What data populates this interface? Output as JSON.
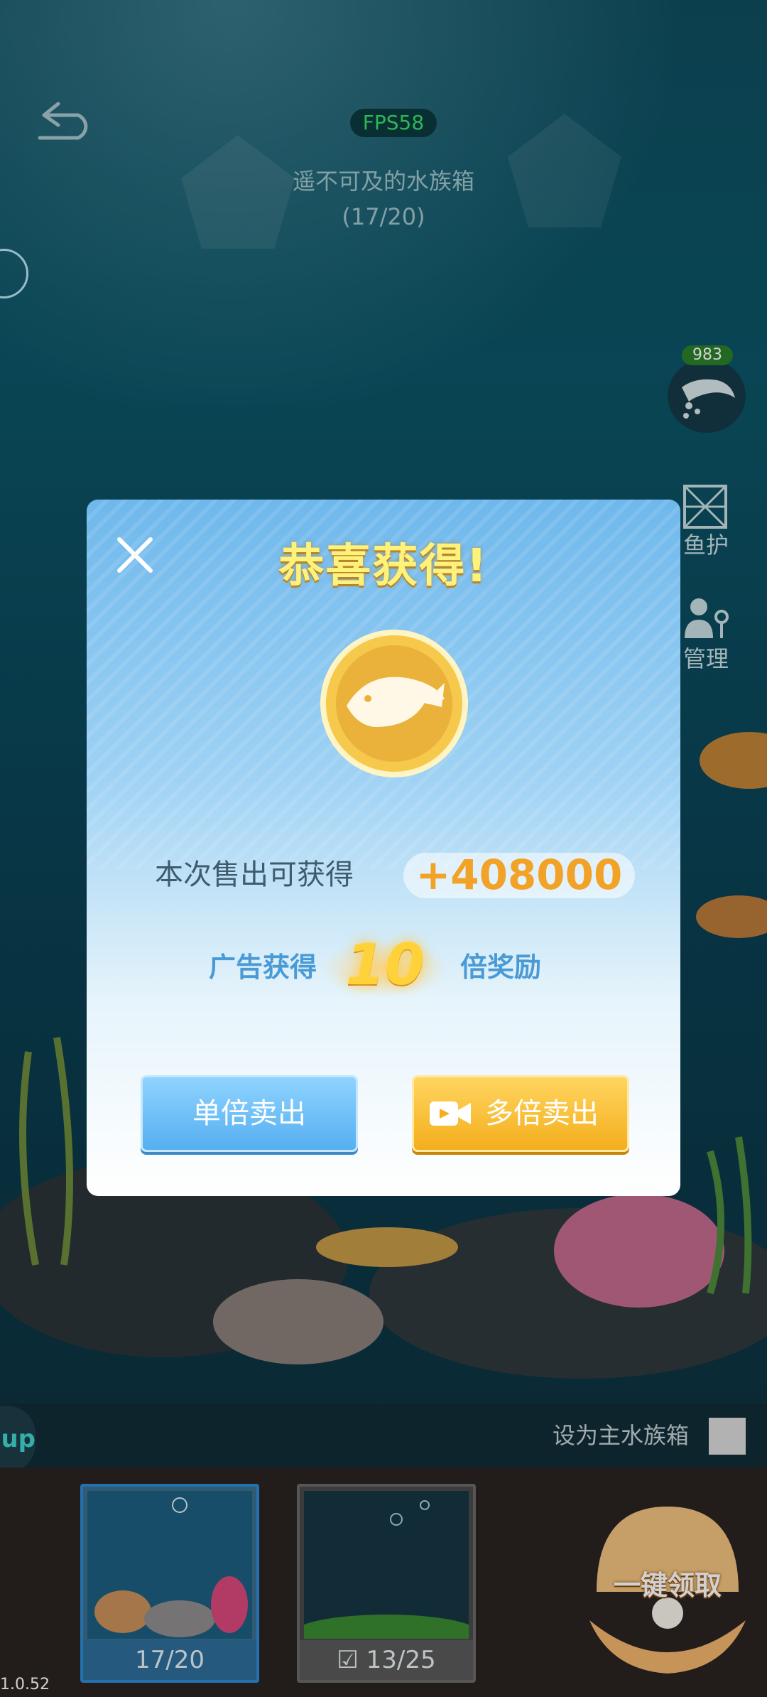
{
  "hud": {
    "fps": "FPS58",
    "tank_name": "遥不可及的水族箱",
    "tank_capacity": "(17/20)",
    "feed_count": "983",
    "side_buttons": [
      "鱼护",
      "管理"
    ]
  },
  "bottom_bar": {
    "set_main_label": "设为主水族箱",
    "up_label": "up",
    "tanks": [
      {
        "caption": "17/20",
        "selected": true
      },
      {
        "caption": "13/25",
        "checked": true
      }
    ],
    "collect_all_label": "一键领取"
  },
  "version": "1.0.52",
  "dialog": {
    "title": "恭喜获得!",
    "sale_label": "本次售出可获得",
    "sale_value": "+408000",
    "ad_prefix": "广告获得",
    "ad_multiplier": "10",
    "ad_suffix": "倍奖励",
    "single_sell_label": "单倍卖出",
    "multi_sell_label": "多倍卖出"
  },
  "colors": {
    "accent_gold": "#f2a226",
    "button_blue": "#55aff0",
    "button_gold": "#f4ae1c",
    "fps_green": "#36e06a"
  },
  "icons": [
    "back-icon",
    "close-icon",
    "fish-coin-icon",
    "video-icon",
    "feed-icon",
    "fish-net-icon",
    "manage-icon",
    "pearl-shell-icon",
    "checkbox-icon"
  ]
}
